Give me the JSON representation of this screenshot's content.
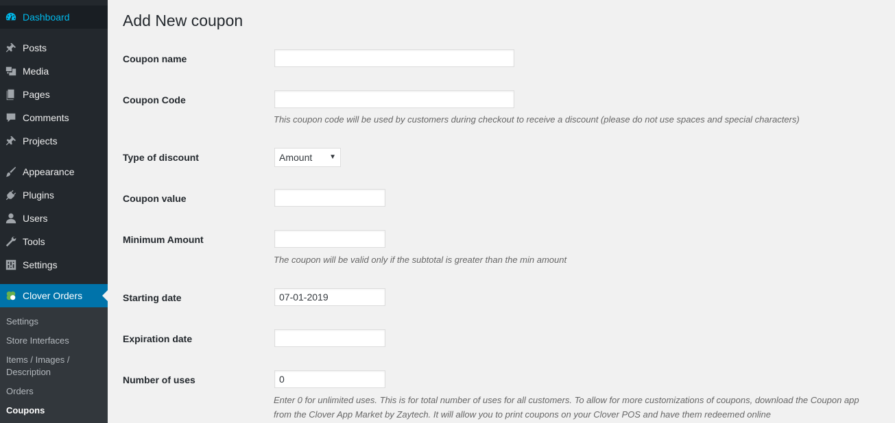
{
  "sidebar": {
    "items": [
      {
        "label": "Dashboard",
        "icon": "dashboard-icon"
      },
      {
        "label": "Posts",
        "icon": "pin-icon"
      },
      {
        "label": "Media",
        "icon": "media-icon"
      },
      {
        "label": "Pages",
        "icon": "pages-icon"
      },
      {
        "label": "Comments",
        "icon": "comment-icon"
      },
      {
        "label": "Projects",
        "icon": "pin-icon"
      },
      {
        "label": "Appearance",
        "icon": "brush-icon"
      },
      {
        "label": "Plugins",
        "icon": "plug-icon"
      },
      {
        "label": "Users",
        "icon": "user-icon"
      },
      {
        "label": "Tools",
        "icon": "wrench-icon"
      },
      {
        "label": "Settings",
        "icon": "sliders-icon"
      },
      {
        "label": "Clover Orders",
        "icon": "clover-icon"
      }
    ],
    "submenu": [
      "Settings",
      "Store Interfaces",
      "Items / Images / Description",
      "Orders",
      "Coupons"
    ]
  },
  "main": {
    "title": "Add New coupon",
    "fields": {
      "coupon_name": {
        "label": "Coupon name",
        "value": ""
      },
      "coupon_code": {
        "label": "Coupon Code",
        "value": "",
        "desc": "This coupon code will be used by customers during checkout to receive a discount (please do not use spaces and special characters)"
      },
      "discount_type": {
        "label": "Type of discount",
        "value": "Amount"
      },
      "coupon_value": {
        "label": "Coupon value",
        "value": ""
      },
      "minimum_amount": {
        "label": "Minimum Amount",
        "value": "",
        "desc": "The coupon will be valid only if the subtotal is greater than the min amount"
      },
      "starting_date": {
        "label": "Starting date",
        "value": "07-01-2019"
      },
      "expiration_date": {
        "label": "Expiration date",
        "value": ""
      },
      "number_of_uses": {
        "label": "Number of uses",
        "value": "0",
        "desc_line1": "Enter 0 for unlimited uses. This is for total number of uses for all customers. To allow for more customizations of coupons, download the Coupon app",
        "desc_line2": "from the Clover App Market by Zaytech. It will allow you to print coupons on your Clover POS and have them redeemed online"
      }
    }
  },
  "colors": {
    "sidebar_bg": "#23282d",
    "accent": "#0073aa",
    "dashboard_text": "#00b9eb",
    "page_bg": "#f1f1f1"
  }
}
